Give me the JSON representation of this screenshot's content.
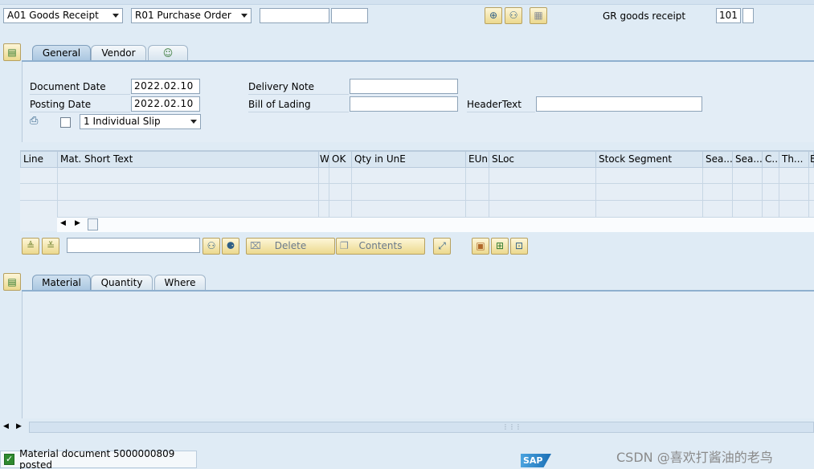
{
  "header": {
    "transaction": "A01 Goods Receipt",
    "reference": "R01 Purchase Order",
    "field1": "",
    "field2": "",
    "gr_label": "GR goods receipt",
    "movement_type": "101",
    "movement_extra": ""
  },
  "toolbar_top": {
    "execute_icon": "execute-icon",
    "find_icon": "binoculars-icon",
    "grid_icon": "calculator-icon"
  },
  "tabs_header": [
    {
      "label": "General"
    },
    {
      "label": "Vendor"
    },
    {
      "label": ""
    }
  ],
  "general": {
    "document_date_label": "Document Date",
    "document_date": "2022.02.10",
    "posting_date_label": "Posting Date",
    "posting_date": "2022.02.10",
    "delivery_note_label": "Delivery Note",
    "delivery_note": "",
    "bill_of_lading_label": "Bill of Lading",
    "bill_of_lading": "",
    "header_text_label": "HeaderText",
    "header_text": "",
    "slip_option": "1 Individual Slip"
  },
  "table": {
    "columns": [
      "Line",
      "Mat. Short Text",
      "W",
      "OK",
      "Qty in UnE",
      "EUn",
      "SLoc",
      "Stock Segment",
      "Sea...",
      "Sea...",
      "C...",
      "Th...",
      "E"
    ],
    "rows": []
  },
  "item_toolbar": {
    "search_value": "",
    "delete_label": "Delete",
    "contents_label": "Contents"
  },
  "tabs_item": [
    {
      "label": "Material"
    },
    {
      "label": "Quantity"
    },
    {
      "label": "Where"
    }
  ],
  "status": {
    "message": "Material document 5000000809 posted",
    "type": "success"
  },
  "watermark": "CSDN @喜欢打酱油的老鸟",
  "colors": {
    "background": "#dfebf5",
    "accent": "#8fb0cf",
    "button": "#ecd98e"
  }
}
